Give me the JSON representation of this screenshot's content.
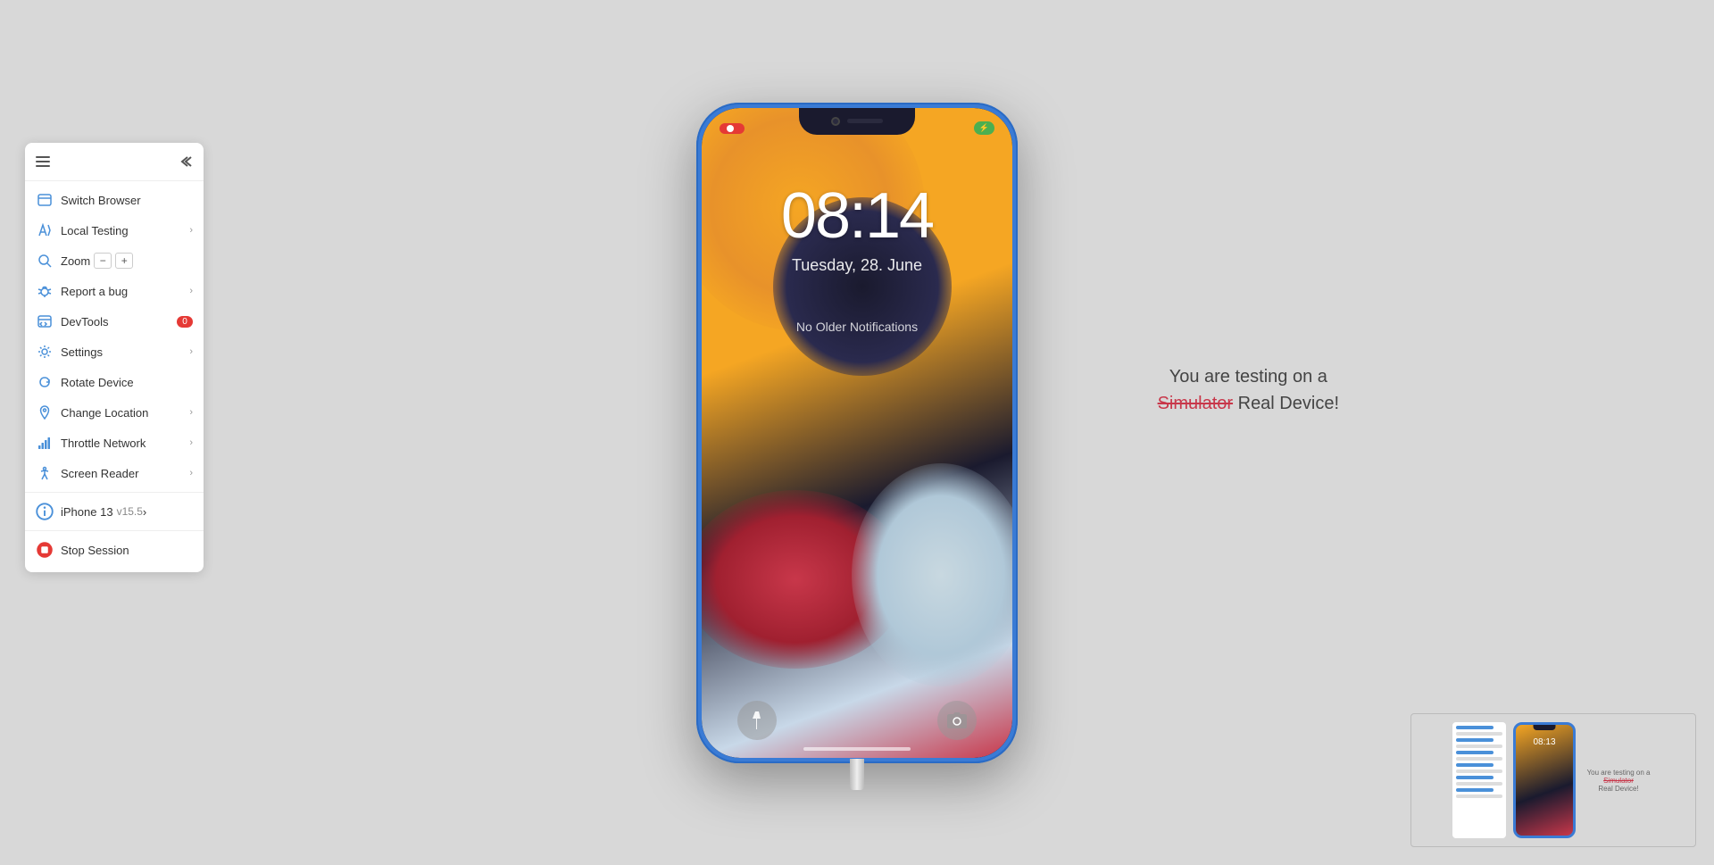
{
  "sidebar": {
    "items": [
      {
        "id": "switch-browser",
        "label": "Switch Browser",
        "icon": "browser-icon",
        "hasChevron": false,
        "badge": null
      },
      {
        "id": "local-testing",
        "label": "Local Testing",
        "icon": "local-testing-icon",
        "hasChevron": true,
        "badge": null
      },
      {
        "id": "zoom",
        "label": "Zoom",
        "icon": "zoom-icon",
        "hasChevron": false,
        "badge": null,
        "isZoom": true
      },
      {
        "id": "report-bug",
        "label": "Report a bug",
        "icon": "bug-icon",
        "hasChevron": true,
        "badge": null
      },
      {
        "id": "devtools",
        "label": "DevTools",
        "icon": "devtools-icon",
        "hasChevron": false,
        "badge": "0"
      },
      {
        "id": "settings",
        "label": "Settings",
        "icon": "settings-icon",
        "hasChevron": true,
        "badge": null
      },
      {
        "id": "rotate-device",
        "label": "Rotate Device",
        "icon": "rotate-icon",
        "hasChevron": false,
        "badge": null
      },
      {
        "id": "change-location",
        "label": "Change Location",
        "icon": "location-icon",
        "hasChevron": true,
        "badge": null
      },
      {
        "id": "throttle-network",
        "label": "Throttle Network",
        "icon": "network-icon",
        "hasChevron": true,
        "badge": null
      },
      {
        "id": "screen-reader",
        "label": "Screen Reader",
        "icon": "accessibility-icon",
        "hasChevron": true,
        "badge": null
      }
    ],
    "device": {
      "name": "iPhone 13",
      "version": "v15.5",
      "hasChevron": true
    },
    "stop_session": "Stop Session"
  },
  "phone": {
    "time": "08:14",
    "date": "Tuesday, 28. June",
    "no_notifications": "No Older Notifications",
    "recording_label": "●",
    "battery_label": "⚡"
  },
  "testing_info": {
    "line1": "You are testing on a",
    "simulator_text": "Simulator",
    "real_device_text": " Real Device!"
  },
  "thumbnail": {
    "time": "08:13",
    "info_line1": "You are testing on a",
    "simulator": "Simulator",
    "real_device": "Real Device!"
  }
}
